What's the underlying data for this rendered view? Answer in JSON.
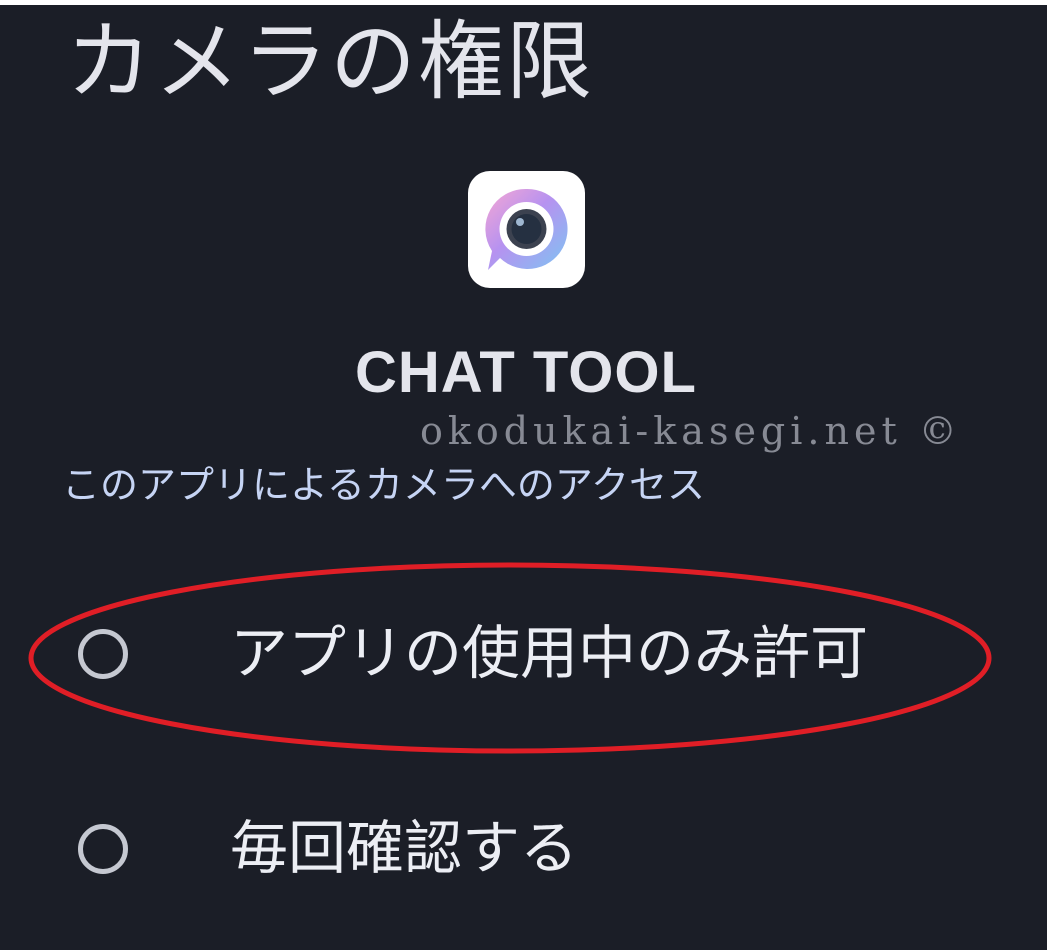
{
  "dialog": {
    "title": "カメラの権限",
    "app_name": "CHAT TOOL",
    "watermark": "okodukai-kasegi.net ©",
    "subtitle": "このアプリによるカメラへのアクセス",
    "options": [
      {
        "label": "アプリの使用中のみ許可",
        "selected": false,
        "highlighted": true
      },
      {
        "label": "毎回確認する",
        "selected": false,
        "highlighted": false
      }
    ]
  },
  "icons": {
    "app_icon": "chat-camera-icon",
    "radio": "radio-unchecked-icon"
  },
  "colors": {
    "background": "#1b1e27",
    "text_primary": "#e4e5ec",
    "text_secondary": "#c6d4f4",
    "radio_outline": "#c5c8d1",
    "annotation_red": "#e01e26"
  }
}
